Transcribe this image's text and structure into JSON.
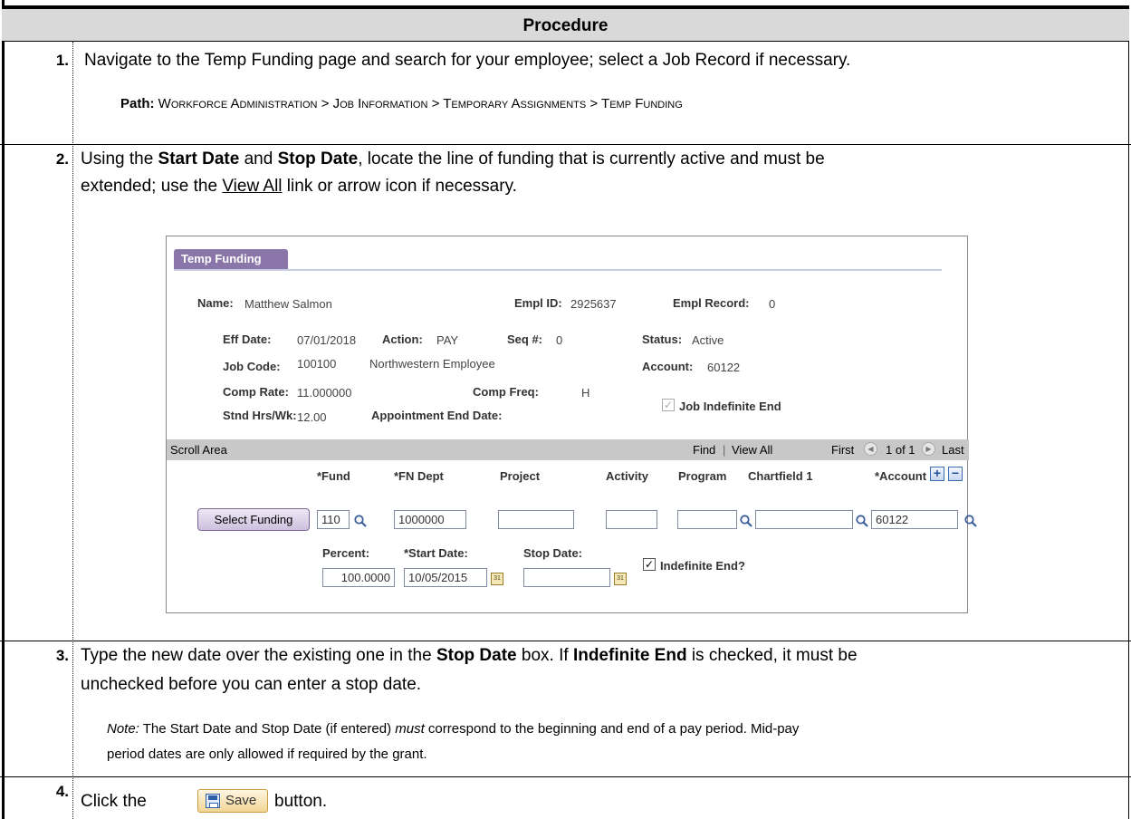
{
  "header": {
    "title": "Procedure"
  },
  "steps": [
    {
      "number": "1.",
      "line": "Navigate to the Temp Funding page and search for your employee; select a Job Record if necessary."
    },
    {
      "number": "2.",
      "line1_pre": "Using the ",
      "start_date": "Start Date",
      "and": " and ",
      "stop_date": "Stop Date",
      "line1_post": ", locate the line of funding that is currently active and must be",
      "line2_pre": "extended; use the ",
      "link": "View All",
      "line2_post": " link or arrow icon if necessary."
    },
    {
      "number": "3.",
      "line1_pre": "Type the new date over the existing one in the ",
      "stop_date": "Stop Date",
      "line1_mid": " box. If ",
      "indefinite_end": "Indefinite End",
      "line1_post": " is checked, it must be",
      "line2": "unchecked before you can enter a stop date."
    },
    {
      "number": "4.",
      "pre": "Click the ",
      "post": "button."
    }
  ],
  "path": {
    "label": "Path:",
    "value": "Workforce Administration > Job Information > Temporary Assignments > Temp Funding"
  },
  "note": {
    "label": "Note:",
    "line1_pre": " The Start Date and Stop Date (if entered) ",
    "must": "must",
    "line1_post": " correspond to the beginning and end of a pay period. Mid-pay",
    "line2": "period dates are only allowed if required by the grant."
  },
  "screenshot": {
    "tab": "Temp Funding",
    "name_label": "Name:",
    "name": "Matthew Salmon",
    "emplid_label": "Empl ID:",
    "emplid": "2925637",
    "emplrec_label": "Empl Record:",
    "emplrec": "0",
    "effdate_label": "Eff Date:",
    "effdate": "07/01/2018",
    "action_label": "Action:",
    "action": "PAY",
    "seq_label": "Seq #:",
    "seq": "0",
    "status_label": "Status:",
    "status": "Active",
    "jobcode_label": "Job Code:",
    "jobcode": "100100",
    "jobcode_desc": "Northwestern Employee",
    "account_label": "Account:",
    "account": "60122",
    "comprate_label": "Comp Rate:",
    "comprate": "11.000000",
    "compfreq_label": "Comp Freq:",
    "compfreq": "H",
    "stdhrs_label": "Stnd Hrs/Wk:",
    "stdhrs": "12.00",
    "apptend_label": "Appointment End Date:",
    "jobindef_label": "Job Indefinite End",
    "scroll_area": "Scroll Area",
    "find": "Find",
    "sep": "|",
    "view_all": "View All",
    "first": "First",
    "count": "1 of 1",
    "last": "Last",
    "select_funding": "Select Funding",
    "fields": {
      "fund_label": "*Fund",
      "fund": "110",
      "fndept_label": "*FN Dept",
      "fndept": "1000000",
      "project_label": "Project",
      "project": "",
      "activity_label": "Activity",
      "activity": "",
      "program_label": "Program",
      "program": "",
      "chartfield_label": "Chartfield 1",
      "chartfield": "",
      "account_label": "*Account",
      "account": "60122",
      "percent_label": "Percent:",
      "percent": "100.0000",
      "startdate_label": "*Start Date:",
      "startdate": "10/05/2015",
      "stopdate_label": "Stop Date:",
      "stopdate": "",
      "indefinite_label": "Indefinite End?"
    }
  },
  "save_button": {
    "label": "Save"
  }
}
